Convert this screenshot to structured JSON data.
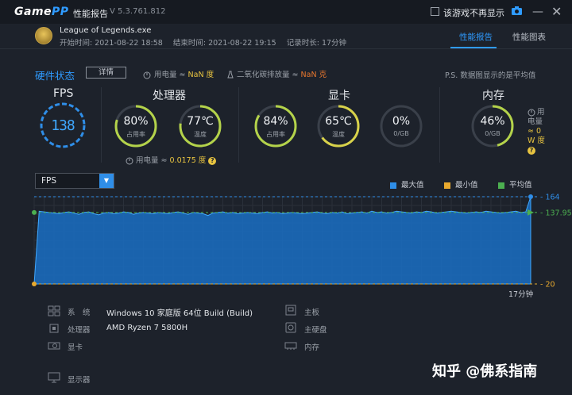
{
  "titlebar": {
    "brand_game": "Game",
    "brand_pp": "PP",
    "title": "性能报告",
    "version": "V 5.3.761.812",
    "no_show_label": "该游戏不再显示",
    "min_icon": "—",
    "close_icon": "✕"
  },
  "game": {
    "name": "League of Legends.exe",
    "start": "开始时间: 2021-08-22 18:58",
    "end": "结束时间: 2021-08-22 19:15",
    "duration": "记录时长: 17分钟"
  },
  "tabs": [
    "性能报告",
    "性能图表"
  ],
  "hardware": {
    "title": "硬件状态",
    "detail_button": "详情",
    "power_label": "用电量 ≈",
    "power_value": "NaN 度",
    "co2_label": "二氧化碳排放量 ≈",
    "co2_value": "NaN 克",
    "note": "P.S. 数据图显示的是平均值"
  },
  "sections": {
    "fps": {
      "title": "FPS",
      "value": "138"
    },
    "cpu": {
      "title": "处理器",
      "usage": {
        "value": "80%",
        "label": "占用率",
        "fraction": 0.8
      },
      "temp": {
        "value": "77℃",
        "label": "温度",
        "fraction": 0.77
      },
      "power_label": "用电量 ≈",
      "power_value": "0.0175 度"
    },
    "gpu": {
      "title": "显卡",
      "usage": {
        "value": "84%",
        "label": "占用率",
        "fraction": 0.84
      },
      "temp": {
        "value": "65℃",
        "label": "温度",
        "fraction": 0.65
      },
      "mem": {
        "value": "0%",
        "label": "0/GB",
        "fraction": 0.0
      }
    },
    "memory": {
      "title": "内存",
      "usage": {
        "value": "46%",
        "label": "0/GB",
        "fraction": 0.46
      },
      "power_line1": "用",
      "power_line2": "电量",
      "power_line3": "≈ 0",
      "power_line4": "W 度"
    }
  },
  "chart_controls": {
    "metric": "FPS",
    "legend": [
      {
        "label": "最大值",
        "color": "#2f8ee8"
      },
      {
        "label": "最小值",
        "color": "#e8a92e"
      },
      {
        "label": "平均值",
        "color": "#4caf50"
      }
    ]
  },
  "chart_data": {
    "type": "area",
    "title": "",
    "xlabel": "17分钟",
    "ylabel": "",
    "ylim": [
      20,
      164
    ],
    "max": 164,
    "min": 20,
    "avg": 137.95,
    "tick_labels": [
      "164",
      "137.95",
      "20"
    ],
    "values": [
      20,
      140,
      139,
      138,
      137,
      136,
      138,
      139,
      137,
      135,
      138,
      139,
      136,
      134,
      137,
      138,
      136,
      137,
      139,
      138,
      135,
      137,
      138,
      137,
      136,
      138,
      137,
      136,
      138,
      139,
      137,
      135,
      138,
      137,
      136,
      133,
      137,
      138,
      139,
      137,
      138,
      136,
      137,
      138,
      137,
      136,
      138,
      139,
      137,
      138,
      136,
      137,
      138,
      137,
      136,
      137,
      138,
      139,
      137,
      136,
      138,
      137,
      139,
      136,
      137,
      138,
      139,
      137,
      140,
      138,
      139,
      137,
      138,
      140,
      139,
      138,
      137,
      139,
      138,
      140,
      139,
      137,
      138,
      139,
      140,
      139,
      138,
      137,
      138,
      139,
      138,
      140,
      139,
      138,
      137,
      138,
      139,
      140,
      138,
      139,
      164
    ]
  },
  "system_info": {
    "os_label": "系　统",
    "os_value": "Windows 10 家庭版 64位   Build (Build)",
    "cpu_label": "处理器",
    "cpu_value": "AMD Ryzen 7 5800H",
    "gpu_label": "显卡",
    "gpu_value": "",
    "display_label": "显示器",
    "display_value": "",
    "board_label": "主板",
    "board_value": "",
    "disk_label": "主硬盘",
    "disk_value": "",
    "ram_label": "内存",
    "ram_value": ""
  },
  "watermark": "知乎 @佛系指南"
}
